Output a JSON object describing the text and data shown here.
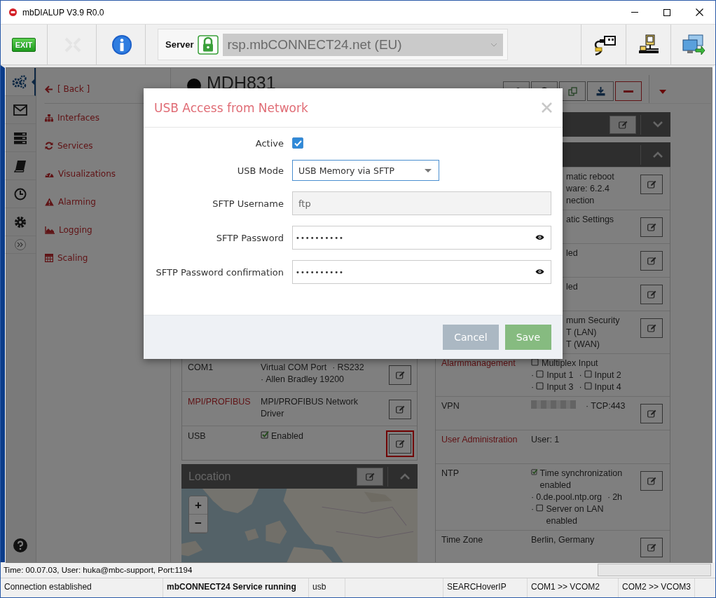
{
  "window": {
    "title": "mbDIALUP V3.9 R0.0"
  },
  "toolbar": {
    "exit_label": "EXIT",
    "server_label": "Server",
    "secure": true,
    "server": "rsp.mbCONNECT24.net (EU)"
  },
  "rail": [
    {
      "selected": true
    },
    {
      "selected": false
    },
    {
      "selected": false
    },
    {
      "selected": false
    },
    {
      "selected": false
    },
    {
      "selected": false
    }
  ],
  "nav": [
    {
      "label": "[ Back ]"
    },
    {
      "label": "Interfaces"
    },
    {
      "label": "Services"
    },
    {
      "label": "Visualizations"
    },
    {
      "label": "Alarming"
    },
    {
      "label": "Logging"
    },
    {
      "label": "Scaling"
    }
  ],
  "device": {
    "name": "MDH831"
  },
  "interfaces": [
    {
      "name": "COM1",
      "highlight": false,
      "selected": false,
      "parts": [
        {
          "text": "Virtual COM Port"
        },
        {
          "prefix": "·",
          "text": "RS232"
        },
        {
          "prefix": "·",
          "text": "Allen Bradley 19200"
        }
      ]
    },
    {
      "name": "MPI/PROFIBUS",
      "highlight": true,
      "selected": false,
      "parts": [
        {
          "text": "MPI/PROFIBUS Network Driver"
        }
      ]
    },
    {
      "name": "USB",
      "highlight": false,
      "selected": true,
      "parts": [
        {
          "checked": true,
          "text": "Enabled"
        }
      ]
    }
  ],
  "location": {
    "title": "Location",
    "map_controls": [
      "+",
      "−"
    ]
  },
  "settings": [
    {
      "editable": true,
      "lines": [
        [
          {
            "text": "matic reboot"
          }
        ],
        [
          {
            "text": "ware: 6.2.4"
          }
        ],
        [
          {
            "text": "nection"
          }
        ]
      ]
    },
    {
      "editable": true,
      "lines": [
        [
          {
            "text": "atic Settings"
          }
        ]
      ]
    },
    {
      "editable": true,
      "lines": [
        [
          {
            "text": "led"
          }
        ]
      ]
    },
    {
      "editable": true,
      "lines": [
        [
          {
            "text": "led"
          }
        ]
      ]
    },
    {
      "editable": true,
      "lines": [
        [
          {
            "text": "mum Security"
          }
        ],
        [
          {
            "text": "T (LAN)"
          }
        ],
        [
          {
            "text": "T (WAN)"
          }
        ]
      ]
    },
    {
      "label": "Alarmmanagement",
      "highlight": true,
      "editable": false,
      "lines": [
        [
          {
            "checked": false,
            "text": "Multiplex Input"
          }
        ],
        [
          {
            "prefix": "·",
            "checked": false,
            "text": "Input 1"
          },
          {
            "prefix": "·",
            "checked": false,
            "text": "Input 2"
          }
        ],
        [
          {
            "prefix": "·",
            "checked": false,
            "text": "Input 3"
          },
          {
            "prefix": "·",
            "checked": false,
            "text": "Input 4"
          }
        ]
      ]
    },
    {
      "label": "VPN",
      "highlight": false,
      "editable": true,
      "lines": [
        [
          {
            "redacted": true
          },
          {
            "prefix": "·",
            "text": "TCP:443"
          }
        ]
      ]
    },
    {
      "label": "User Administration",
      "highlight": true,
      "editable": false,
      "lines": [
        [
          {
            "text": "User: 1"
          }
        ]
      ]
    },
    {
      "label": "NTP",
      "highlight": false,
      "editable": true,
      "lines": [
        [
          {
            "checked": true,
            "text": "Time synchronization enabled"
          }
        ],
        [
          {
            "prefix": "·",
            "text": "0.de.pool.ntp.org"
          },
          {
            "prefix": "·",
            "text": "2h"
          }
        ],
        [
          {
            "prefix": "·",
            "checked": false,
            "text": "Server on LAN enabled"
          }
        ]
      ]
    },
    {
      "label": "Time Zone",
      "highlight": false,
      "editable": true,
      "lines": [
        [
          {
            "text": "Berlin, Germany"
          }
        ]
      ]
    }
  ],
  "dialog": {
    "title": "USB Access from Network",
    "fields": [
      {
        "kind": "checkbox",
        "label": "Active",
        "checked": true
      },
      {
        "kind": "select",
        "label": "USB Mode",
        "value": "USB Memory via SFTP"
      },
      {
        "kind": "text",
        "label": "SFTP Username",
        "value": "ftp",
        "disabled": true
      },
      {
        "kind": "password",
        "label": "SFTP Password",
        "value": "••••••••••"
      },
      {
        "kind": "password",
        "label": "SFTP Password confirmation",
        "value": "••••••••••"
      }
    ],
    "buttons": [
      {
        "kind": "cancel",
        "label": "Cancel"
      },
      {
        "kind": "save",
        "label": "Save"
      }
    ]
  },
  "status_line": {
    "text": "Time: 00.07.03, User: huka@mbc-support, Port:1194",
    "level": 0
  },
  "status_bar": [
    {
      "text": "Connection established",
      "bold": false
    },
    {
      "text": "mbCONNECT24 Service running",
      "bold": true
    },
    {
      "text": "usb",
      "bold": false
    },
    {
      "text": "SEARCHoverIP",
      "bold": false
    },
    {
      "text": "COM1 >> VCOM2",
      "bold": false
    },
    {
      "text": "COM2 >> VCOM3",
      "bold": false
    }
  ]
}
